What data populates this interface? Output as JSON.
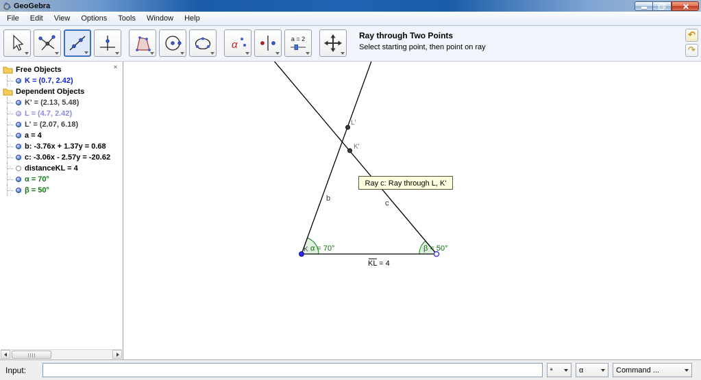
{
  "titlebar": {
    "title": "GeoGebra"
  },
  "menu": {
    "items": [
      "File",
      "Edit",
      "View",
      "Options",
      "Tools",
      "Window",
      "Help"
    ]
  },
  "toolbar": {
    "help_title": "Ray through Two Points",
    "help_subtitle": "Select starting point, then point on ray",
    "selected_tool": "line",
    "tools": [
      {
        "name": "move"
      },
      {
        "name": "point"
      },
      {
        "name": "line"
      },
      {
        "name": "perpendicular-line"
      },
      {
        "name": "polygon"
      },
      {
        "name": "circle"
      },
      {
        "name": "conic"
      },
      {
        "name": "angle"
      },
      {
        "name": "reflect"
      },
      {
        "name": "slider",
        "label": "a = 2"
      },
      {
        "name": "move-graphics-view"
      }
    ]
  },
  "icons": {
    "undo": "↶",
    "redo": "↷",
    "angle_glyph": "α",
    "panel_close": "×"
  },
  "algebra": {
    "sections": [
      {
        "label": "Free Objects",
        "items": [
          {
            "text": "K = (0.7, 2.42)"
          }
        ]
      },
      {
        "label": "Dependent Objects",
        "items": [
          {
            "text": "K' = (2.13, 5.48)"
          },
          {
            "text": "L = (4.7, 2.42)"
          },
          {
            "text": "L' = (2.07, 6.18)"
          },
          {
            "text": "a = 4"
          },
          {
            "text": "b: -3.76x + 1.37y = 0.68"
          },
          {
            "text": "c: -3.06x - 2.57y = -20.62"
          },
          {
            "text": "distanceKL = 4"
          },
          {
            "text": "α = 70°"
          },
          {
            "text": "β = 50°"
          }
        ]
      }
    ]
  },
  "canvas": {
    "tooltip": "Ray c: Ray through L, K'",
    "labels": {
      "line_b": "b",
      "line_c": "c",
      "point_K": "K",
      "point_K_prime": "K'",
      "point_L_prime": "L'",
      "angle_alpha": "α = 70°",
      "angle_beta": "β = 50°",
      "segment_KL": "KL = 4"
    },
    "colors": {
      "point_blue": "#2A2AE0",
      "angle_green": "#118011",
      "tooltip_bg": "#FFFFE0"
    }
  },
  "inputbar": {
    "label": "Input:",
    "value": "",
    "superscript_dropdown": "ª",
    "greek_dropdown": "α",
    "command_dropdown": "Command ..."
  }
}
